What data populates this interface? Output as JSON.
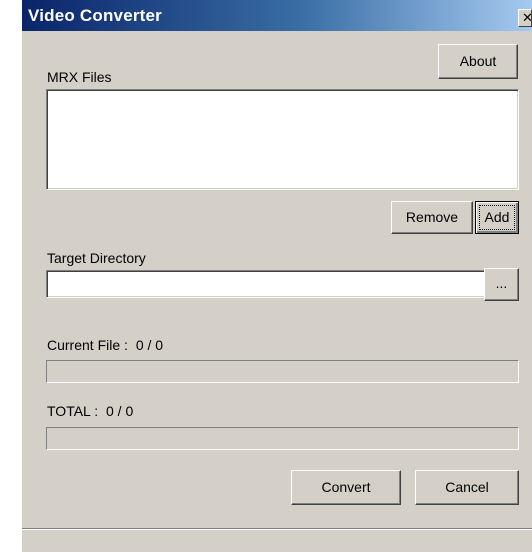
{
  "window": {
    "title": "Video Converter",
    "close_glyph": "✕",
    "colors": {
      "face": "#d4d0c8",
      "title_start": "#0a246a",
      "title_end": "#a6caf0"
    }
  },
  "header": {
    "about_label": "About"
  },
  "files": {
    "label": "MRX Files",
    "items": [],
    "remove_label": "Remove",
    "add_label": "Add"
  },
  "target": {
    "label": "Target Directory",
    "value": "",
    "browse_label": "..."
  },
  "current_file": {
    "label": "Current File :",
    "counter": "0 / 0",
    "progress": 0
  },
  "total": {
    "label": "TOTAL :",
    "counter": "0 / 0",
    "progress": 0
  },
  "actions": {
    "convert_label": "Convert",
    "cancel_label": "Cancel"
  },
  "status": {
    "text": ""
  }
}
